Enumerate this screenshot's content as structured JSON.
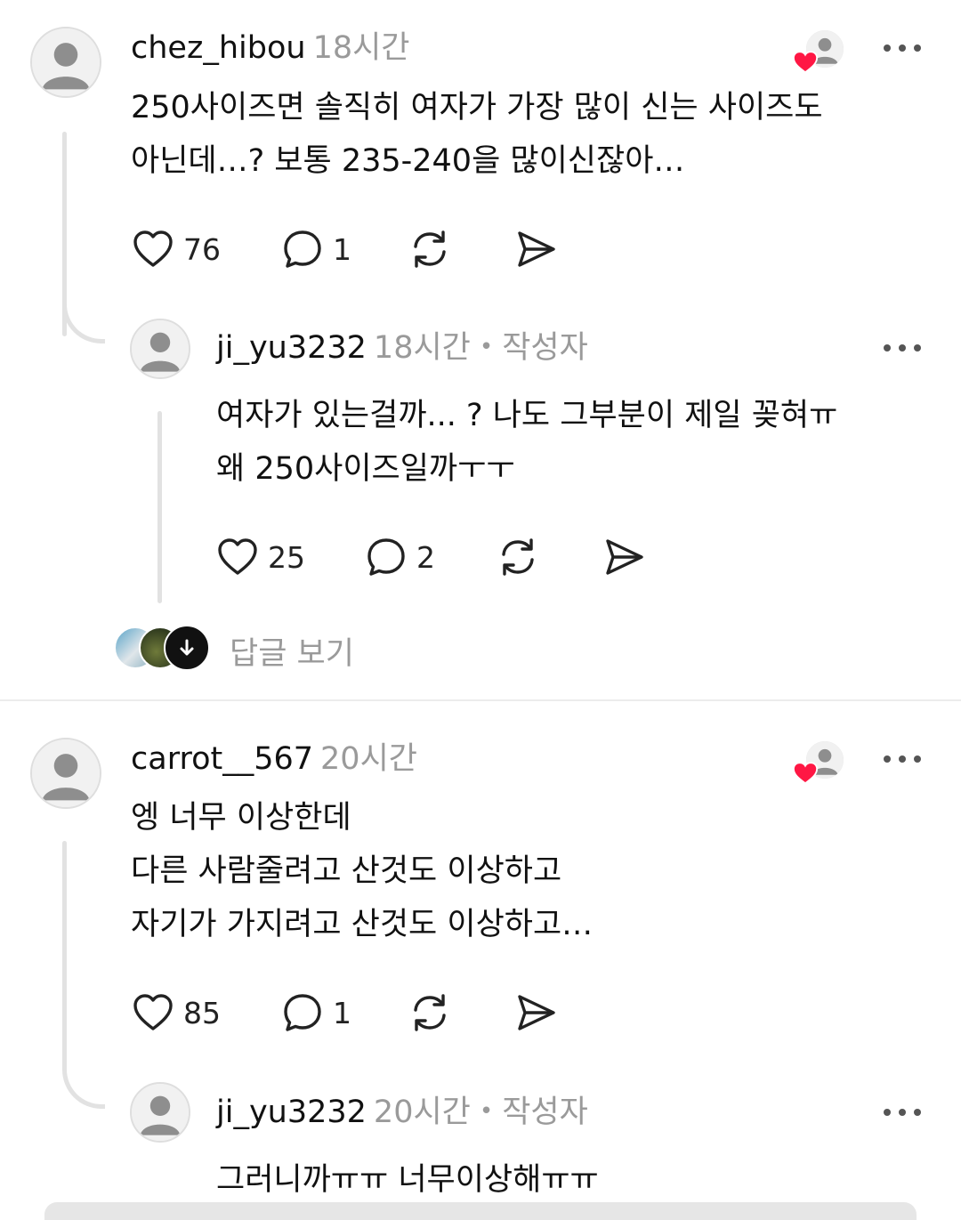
{
  "comments": [
    {
      "username": "chez_hibou",
      "time": "18시간",
      "lines": [
        "250사이즈면 솔직히 여자가 가장 많이 신는 사이즈도",
        "아닌데…? 보통 235-240을 많이신잖아…"
      ],
      "likes": "76",
      "replies": "1"
    },
    {
      "username": "ji_yu3232",
      "time": "18시간",
      "dot": "•",
      "author_tag": "작성자",
      "lines": [
        "여자가 있는걸까... ? 나도 그부분이 제일 꽂혀ㅠ",
        "왜 250사이즈일까ㅜㅜ"
      ],
      "likes": "25",
      "replies": "2"
    },
    {
      "username": "carrot__567",
      "time": "20시간",
      "lines": [
        "엥 너무 이상한데",
        "다른 사람줄려고 산것도 이상하고",
        "자기가 가지려고 산것도 이상하고…"
      ],
      "likes": "85",
      "replies": "1"
    },
    {
      "username": "ji_yu3232",
      "time": "20시간",
      "dot": "•",
      "author_tag": "작성자",
      "lines": [
        "그러니까ㅠㅠ 너무이상해ㅠㅠ"
      ]
    }
  ],
  "view_replies": "답글 보기",
  "icons": {
    "like": "heart-outline-icon",
    "reply": "speech-bubble-icon",
    "repost": "repost-arrows-icon",
    "share": "paper-plane-icon",
    "more": "ellipsis-icon",
    "liked_by_author": "red-heart-avatar-badge"
  },
  "colors": {
    "text": "#111111",
    "muted": "#9a9a9a",
    "line": "#e2e2e2",
    "heart": "#ff1744"
  }
}
